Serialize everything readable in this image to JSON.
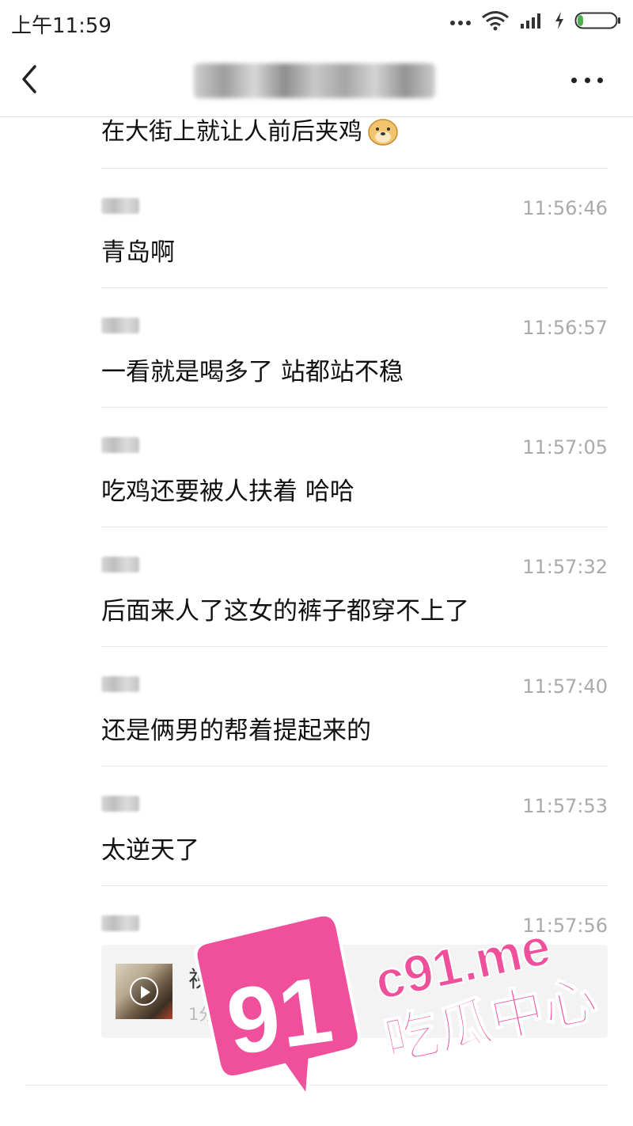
{
  "status_bar": {
    "time": "上午11:59",
    "icons": [
      "more-dots-icon",
      "wifi-icon",
      "signal-icon",
      "charging-icon",
      "battery-icon"
    ]
  },
  "nav": {
    "back_icon": "chevron-left-icon",
    "more_icon": "more-horizontal-icon"
  },
  "first_message": {
    "text": "在大街上就让人前后夹鸡",
    "emoji": "doge-emoji-icon"
  },
  "messages": [
    {
      "time": "11:56:46",
      "text": "青岛啊"
    },
    {
      "time": "11:56:57",
      "text": "一看就是喝多了 站都站不稳"
    },
    {
      "time": "11:57:05",
      "text": "吃鸡还要被人扶着 哈哈"
    },
    {
      "time": "11:57:32",
      "text": "后面来人了这女的裤子都穿不上了"
    },
    {
      "time": "11:57:40",
      "text": "还是俩男的帮着提起来的"
    },
    {
      "time": "11:57:53",
      "text": "太逆天了"
    },
    {
      "time": "11:57:56",
      "text": ""
    }
  ],
  "video": {
    "title": "视频",
    "duration": "1分7秒"
  },
  "watermark": {
    "badge": "91",
    "domain": "c91.me",
    "slogan": "吃瓜中心",
    "color": "#f0509b"
  }
}
